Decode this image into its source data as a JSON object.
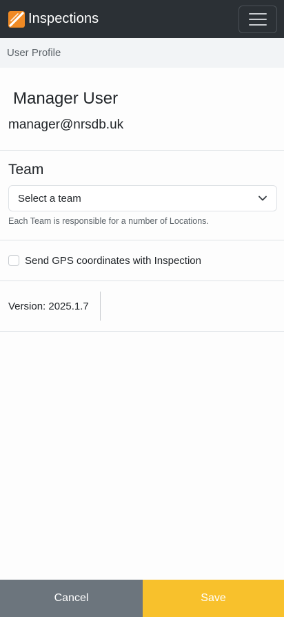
{
  "navbar": {
    "brand": "Inspections",
    "logo_icon": "inspections-logo-icon",
    "menu_icon": "hamburger-menu-icon",
    "colors": {
      "background": "#2b3035",
      "logo_orange": "#f08a24"
    }
  },
  "breadcrumb": {
    "label": "User Profile"
  },
  "profile": {
    "name": "Manager User",
    "email": "manager@nrsdb.uk"
  },
  "team": {
    "label": "Team",
    "selected": "Select a team",
    "help": "Each Team is responsible for a number of Locations."
  },
  "gps": {
    "label": "Send GPS coordinates with Inspection",
    "checked": false
  },
  "version": {
    "text": "Version: 2025.1.7"
  },
  "footer": {
    "cancel_label": "Cancel",
    "save_label": "Save",
    "colors": {
      "cancel": "#6c757d",
      "save": "#f8c12c"
    }
  }
}
